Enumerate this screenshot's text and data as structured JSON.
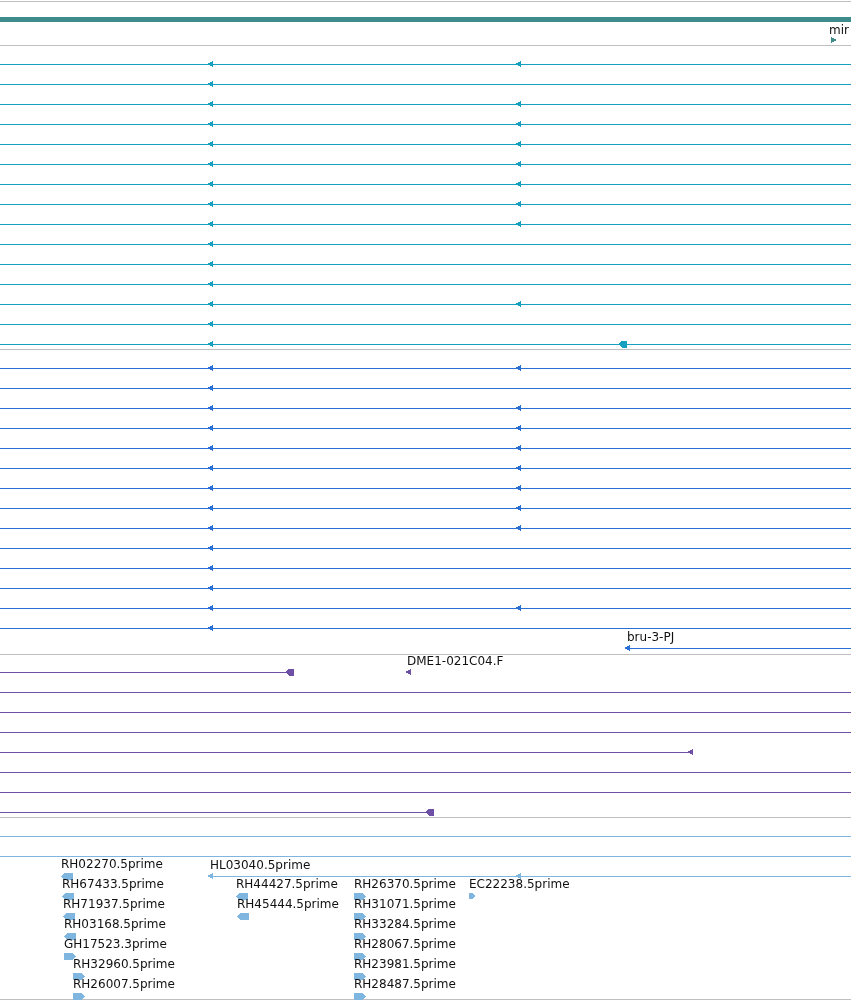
{
  "overview": {
    "color": "#3f8c8c"
  },
  "tracks": [
    {
      "color": "#3f8c8c",
      "features": [
        {
          "kind": "transcript",
          "label": "mir",
          "reverse": false
        }
      ]
    },
    {
      "color": "#17a0bf",
      "features": [
        {
          "kind": "transcript",
          "reverse": true
        },
        {
          "kind": "transcript",
          "reverse": true
        },
        {
          "kind": "transcript",
          "reverse": true
        },
        {
          "kind": "transcript",
          "reverse": true
        },
        {
          "kind": "transcript",
          "reverse": true
        },
        {
          "kind": "transcript",
          "reverse": true
        },
        {
          "kind": "transcript",
          "reverse": true
        },
        {
          "kind": "transcript",
          "reverse": true
        },
        {
          "kind": "transcript",
          "reverse": true
        },
        {
          "kind": "transcript",
          "reverse": true
        },
        {
          "kind": "transcript",
          "reverse": true
        },
        {
          "kind": "transcript",
          "reverse": true
        },
        {
          "kind": "transcript",
          "reverse": true
        },
        {
          "kind": "transcript",
          "reverse": true
        },
        {
          "kind": "transcript",
          "reverse": true
        }
      ]
    },
    {
      "color": "#2a6fd6",
      "features": [
        {
          "kind": "transcript",
          "reverse": true
        },
        {
          "kind": "transcript",
          "reverse": true
        },
        {
          "kind": "transcript",
          "reverse": true
        },
        {
          "kind": "transcript",
          "reverse": true
        },
        {
          "kind": "transcript",
          "reverse": true
        },
        {
          "kind": "transcript",
          "reverse": true
        },
        {
          "kind": "transcript",
          "reverse": true
        },
        {
          "kind": "transcript",
          "reverse": true
        },
        {
          "kind": "transcript",
          "reverse": true
        },
        {
          "kind": "transcript",
          "reverse": true
        },
        {
          "kind": "transcript",
          "reverse": true
        },
        {
          "kind": "transcript",
          "reverse": true
        },
        {
          "kind": "transcript",
          "reverse": true
        },
        {
          "kind": "transcript",
          "reverse": true
        },
        {
          "kind": "transcript",
          "label": "bru-3-PJ",
          "reverse": true
        }
      ]
    },
    {
      "color": "#6e4fa6",
      "features": [
        {
          "kind": "transcript",
          "reverse": true
        },
        {
          "kind": "transcript",
          "label": "DME1-021C04.F",
          "reverse": true
        },
        {
          "kind": "span"
        },
        {
          "kind": "span"
        },
        {
          "kind": "span"
        },
        {
          "kind": "transcript",
          "reverse": true
        },
        {
          "kind": "span"
        },
        {
          "kind": "span"
        },
        {
          "kind": "transcript",
          "reverse": true
        }
      ]
    },
    {
      "color": "#7fb6df",
      "features": [
        {
          "kind": "span"
        },
        {
          "kind": "span"
        },
        {
          "kind": "est",
          "label": "RH02270.5prime",
          "reverse": true
        },
        {
          "kind": "transcript",
          "label": "HL03040.5prime",
          "reverse": true
        },
        {
          "kind": "est",
          "label": "RH67433.5prime",
          "reverse": true
        },
        {
          "kind": "est",
          "label": "RH44427.5prime",
          "reverse": true
        },
        {
          "kind": "est",
          "label": "RH26370.5prime",
          "reverse": false
        },
        {
          "kind": "est",
          "label": "EC22238.5prime",
          "reverse": false
        },
        {
          "kind": "est",
          "label": "RH71937.5prime",
          "reverse": true
        },
        {
          "kind": "est",
          "label": "RH45444.5prime",
          "reverse": true
        },
        {
          "kind": "est",
          "label": "RH31071.5prime",
          "reverse": false
        },
        {
          "kind": "est",
          "label": "RH03168.5prime",
          "reverse": true
        },
        {
          "kind": "est",
          "label": "RH33284.5prime",
          "reverse": false
        },
        {
          "kind": "est",
          "label": "GH17523.3prime",
          "reverse": false
        },
        {
          "kind": "est",
          "label": "RH28067.5prime",
          "reverse": false
        },
        {
          "kind": "est",
          "label": "RH32960.5prime",
          "reverse": false
        },
        {
          "kind": "est",
          "label": "RH23981.5prime",
          "reverse": false
        },
        {
          "kind": "est",
          "label": "RH26007.5prime",
          "reverse": false
        },
        {
          "kind": "est",
          "label": "RH28487.5prime",
          "reverse": false
        }
      ]
    }
  ]
}
